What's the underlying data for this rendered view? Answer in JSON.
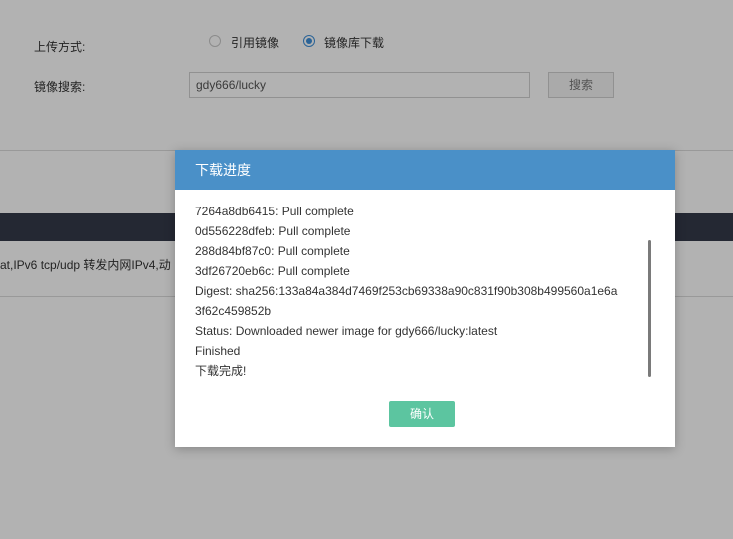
{
  "form": {
    "upload_label": "上传方式:",
    "radio_options": [
      "引用镜像",
      "镜像库下载"
    ],
    "selected_option": "镜像库下载",
    "search_label": "镜像搜索:",
    "search_value": "gdy666/lucky",
    "search_button": "搜索"
  },
  "background": {
    "desc_line": "at,IPv6 tcp/udp 转发内网IPv4,动",
    "desc_line2": ""
  },
  "modal": {
    "title": "下载进度",
    "log": [
      "7264a8db6415: Pull complete",
      "0d556228dfeb: Pull complete",
      "288d84bf87c0: Pull complete",
      "3df26720eb6c: Pull complete",
      "Digest: sha256:133a84a384d7469f253cb69338a90c831f90b308b499560a1e6a",
      "3f62c459852b",
      "Status: Downloaded newer image for gdy666/lucky:latest",
      "Finished",
      "下载完成!"
    ],
    "confirm_button": "确认"
  },
  "colors": {
    "header": "#4a90c8",
    "confirm": "#5cc5a0",
    "radio_checked": "#3d8fd8",
    "dark_bar": "#343a4a"
  }
}
